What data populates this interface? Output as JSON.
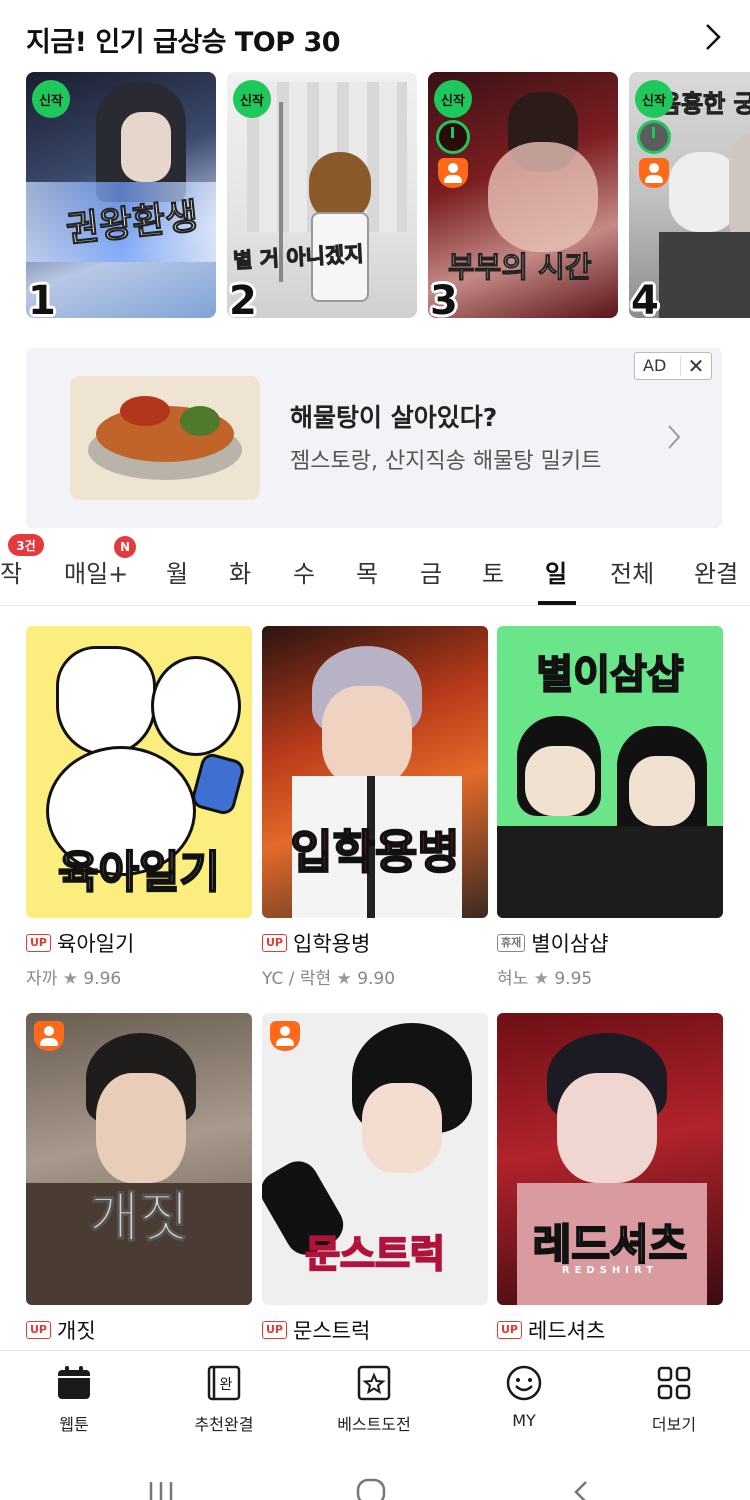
{
  "header": {
    "title": "지금! 인기 급상승 TOP 30",
    "more_icon": "chevron-right-icon"
  },
  "top30": [
    {
      "rank": "1",
      "badge": "신작",
      "cover_text": "권왕환생",
      "timer": false,
      "adult": false
    },
    {
      "rank": "2",
      "badge": "신작",
      "cover_text": "별 거 아니겠지",
      "timer": false,
      "adult": false
    },
    {
      "rank": "3",
      "badge": "신작",
      "cover_text": "부부의 시간",
      "timer": true,
      "adult": true
    },
    {
      "rank": "4",
      "badge": "신작",
      "cover_text": "음흉한 궁",
      "timer": true,
      "adult": true
    }
  ],
  "ad": {
    "badge": "AD",
    "close": "✕",
    "title": "해물탕이 살아있다?",
    "subtitle": "젬스토랑, 산지직송 해물탕 밀키트"
  },
  "tabs": {
    "items": [
      "작",
      "매일+",
      "월",
      "화",
      "수",
      "목",
      "금",
      "토",
      "일",
      "전체",
      "완결"
    ],
    "active": "일",
    "badge_count": "3건",
    "badge_new": "N"
  },
  "comics": [
    {
      "tag": "UP",
      "title": "육아일기",
      "author": "자까",
      "rating": "9.96",
      "cover_text": "육아일기",
      "adult": false
    },
    {
      "tag": "UP",
      "title": "입학용병",
      "author": "YC / 락현",
      "rating": "9.90",
      "cover_text": "입학용병",
      "adult": false
    },
    {
      "tag": "휴재",
      "title": "별이삼샵",
      "author": "혀노",
      "rating": "9.95",
      "cover_text": "별이삼샵",
      "adult": false
    },
    {
      "tag": "UP",
      "title": "개짓",
      "author": "",
      "rating": "",
      "cover_text": "개짓",
      "adult": true
    },
    {
      "tag": "UP",
      "title": "문스트럭",
      "author": "",
      "rating": "",
      "cover_text": "문스트럭",
      "adult": true
    },
    {
      "tag": "UP",
      "title": "레드셔츠",
      "author": "",
      "rating": "",
      "cover_text": "레드셔츠",
      "cover_sub": "REDSHIRT",
      "adult": false
    }
  ],
  "star": "★",
  "bottom_nav": [
    {
      "label": "웹툰",
      "icon": "calendar-icon"
    },
    {
      "label": "추천완결",
      "icon": "book-complete-icon",
      "icon_text": "완"
    },
    {
      "label": "베스트도전",
      "icon": "star-box-icon"
    },
    {
      "label": "MY",
      "icon": "smiley-icon"
    },
    {
      "label": "더보기",
      "icon": "grid-more-icon"
    }
  ],
  "system_nav": [
    "recent-apps-icon",
    "home-icon",
    "back-icon"
  ]
}
